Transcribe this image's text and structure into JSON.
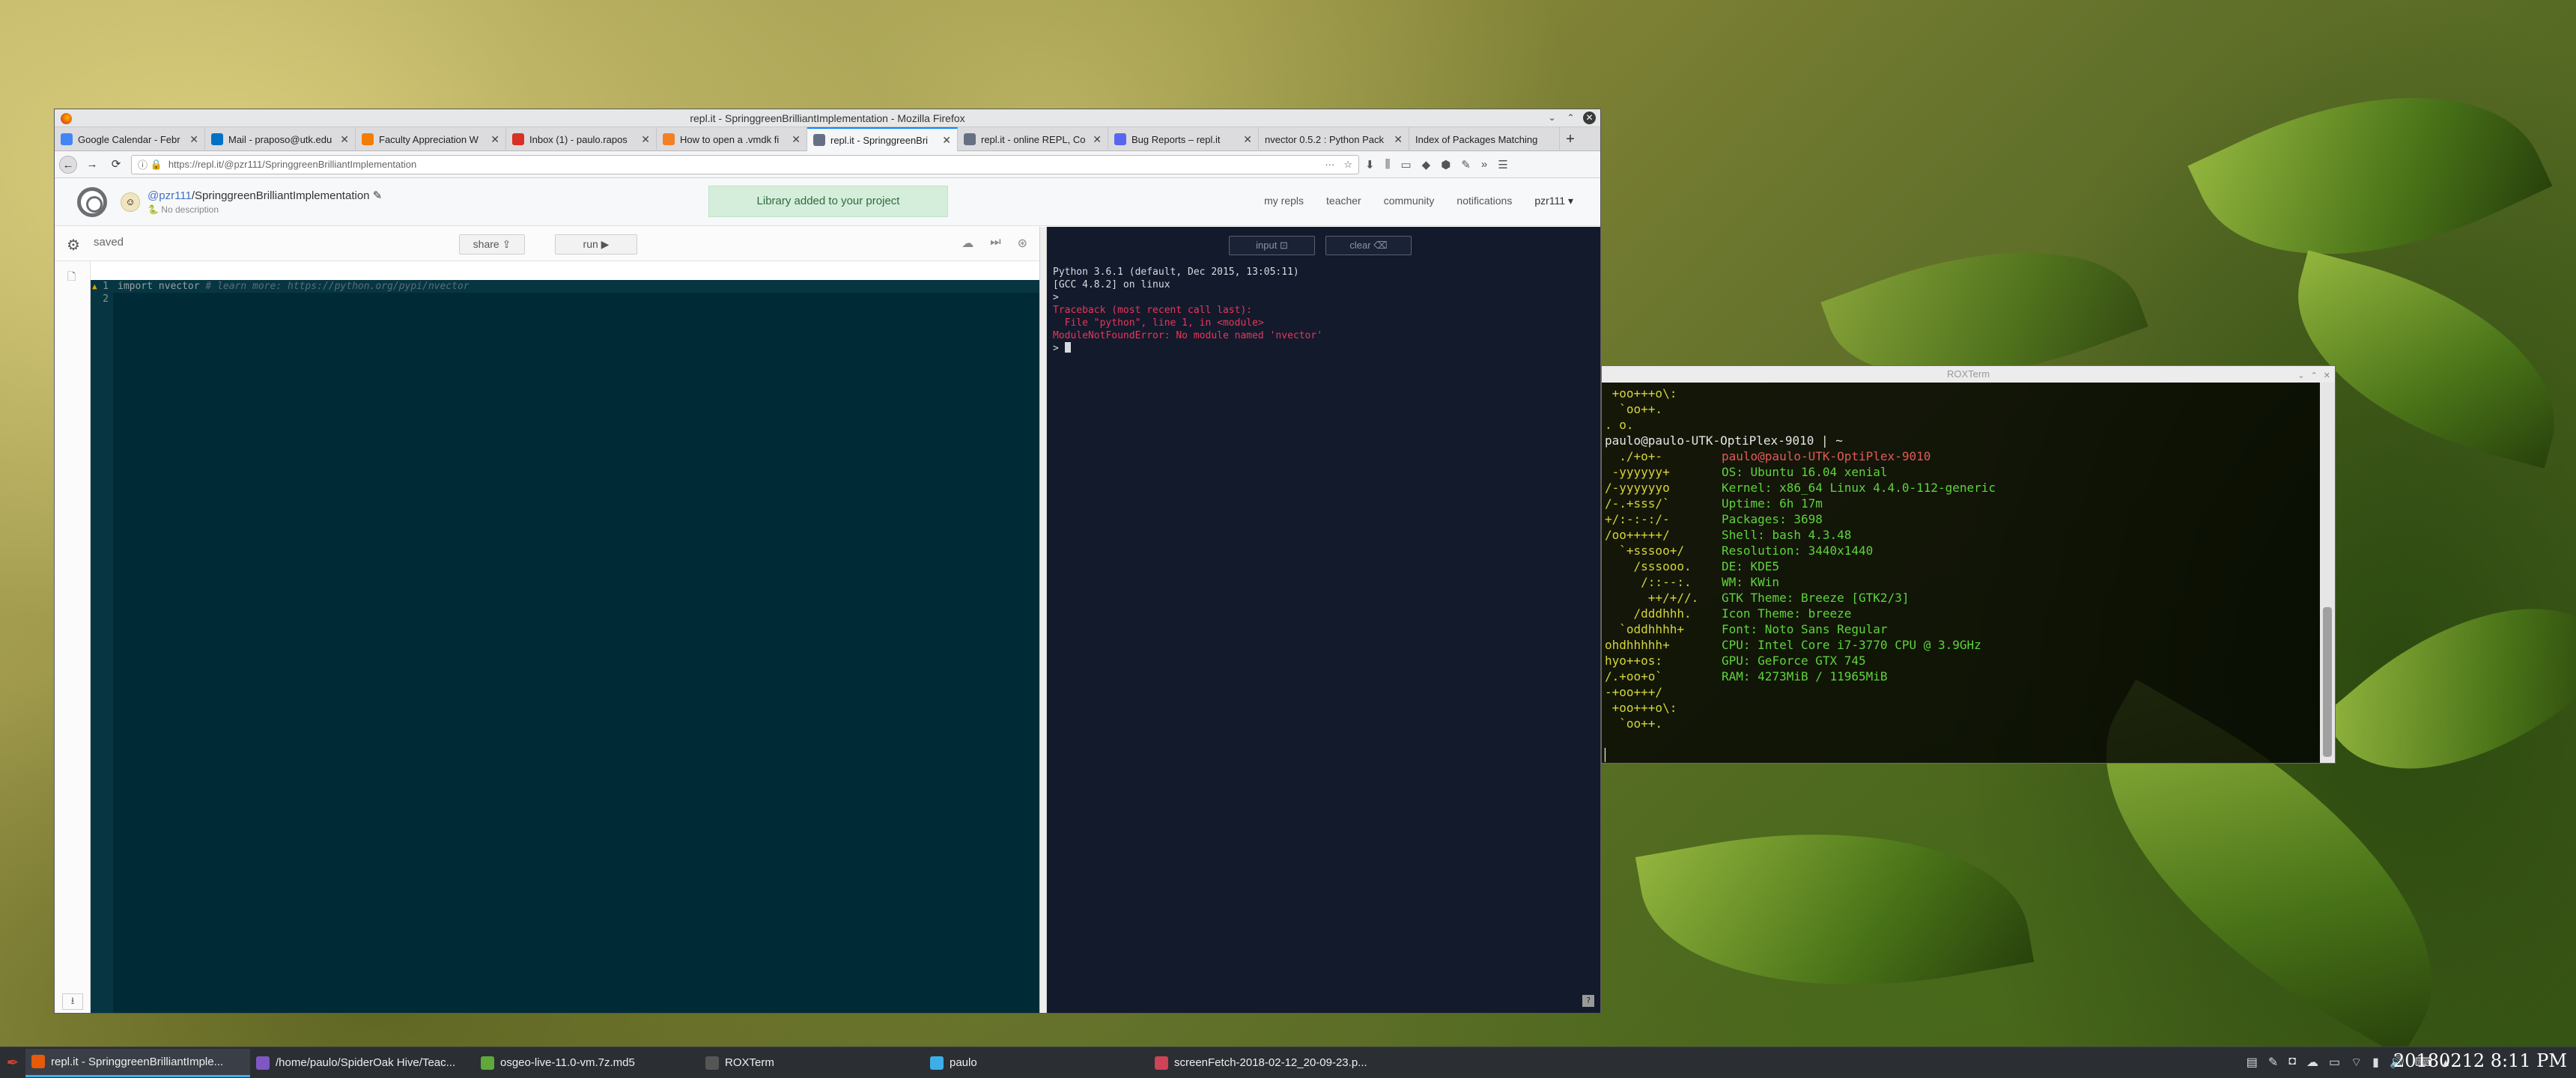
{
  "firefox": {
    "window_title": "repl.it - SpringgreenBrilliantImplementation - Mozilla Firefox",
    "tabs": [
      {
        "label": "Google Calendar - Febr",
        "color": "#4285f4"
      },
      {
        "label": "Mail - praposo@utk.edu",
        "color": "#0072c6"
      },
      {
        "label": "Faculty Appreciation W",
        "color": "#f57c00"
      },
      {
        "label": "Inbox (1) - paulo.rapos",
        "color": "#d93025"
      },
      {
        "label": "How to open a .vmdk fi",
        "color": "#f48024"
      },
      {
        "label": "repl.it - SpringgreenBri",
        "color": "#667085"
      },
      {
        "label": "repl.it - online REPL, Co",
        "color": "#667085"
      },
      {
        "label": "Bug Reports – repl.it",
        "color": "#5865f2"
      },
      {
        "label": "nvector 0.5.2 : Python Pack",
        "color": "#3775a9"
      },
      {
        "label": "Index of Packages Matching",
        "color": "#3775a9"
      }
    ],
    "url": "https://repl.it/@pzr111/SpringgreenBrilliantImplementation"
  },
  "repl": {
    "user": "@pzr111",
    "project": "SpringgreenBrilliantImplementation",
    "description": "No description",
    "toast": "Library added to your project",
    "nav": [
      "my repls",
      "teacher",
      "community",
      "notifications"
    ],
    "username": "pzr111 ▾",
    "saved": "saved",
    "share": "share",
    "run": "run ▶",
    "input": "input",
    "clear": "clear",
    "editor_lines": [
      "1",
      "2"
    ],
    "code_import": "import nvector ",
    "code_comment": "# learn more: https://python.org/pypi/nvector",
    "console": {
      "line1": "Python 3.6.1 (default, Dec 2015, 13:05:11)",
      "line2": "[GCC 4.8.2] on linux",
      "prompt1": ">",
      "err1": "Traceback (most recent call last):",
      "err2": "  File \"python\", line 1, in <module>",
      "err3": "ModuleNotFoundError: No module named 'nvector'",
      "prompt2": "> "
    }
  },
  "roxterm": {
    "title": "ROXTerm",
    "top_art": [
      " +oo+++o\\:",
      "  `oo++.",
      ". o."
    ],
    "prompt": "paulo@paulo-UTK-OptiPlex-9010 | ~",
    "art": [
      "  ./+o+-",
      " -yyyyyy+",
      "/-yyyyyyo",
      "/-.+sss/`",
      "+/:-:-:/-",
      "/oo+++++/",
      "  `+sssoo+/",
      "    /sssooo.",
      "     /::--:.",
      "      ++/+//.",
      "    /dddhhh.",
      "  `oddhhhh+",
      "ohdhhhhh+",
      "hyo++os:",
      "/.+oo+o`",
      "-+oo+++/",
      " +oo+++o\\:",
      "  `oo++.",
      ""
    ],
    "host": "paulo@paulo-UTK-OptiPlex-9010",
    "info": [
      [
        "OS: ",
        "Ubuntu 16.04 xenial"
      ],
      [
        "Kernel: ",
        "x86_64 Linux 4.4.0-112-generic"
      ],
      [
        "Uptime: ",
        "6h 17m"
      ],
      [
        "Packages: ",
        "3698"
      ],
      [
        "Shell: ",
        "bash 4.3.48"
      ],
      [
        "Resolution: ",
        "3440x1440"
      ],
      [
        "DE: ",
        "KDE5"
      ],
      [
        "WM: ",
        "KWin"
      ],
      [
        "GTK Theme: ",
        "Breeze [GTK2/3]"
      ],
      [
        "Icon Theme: ",
        "breeze"
      ],
      [
        "Font: ",
        "Noto Sans Regular"
      ],
      [
        "CPU: ",
        "Intel Core i7-3770 CPU @ 3.9GHz"
      ],
      [
        "GPU: ",
        "GeForce GTX 745"
      ],
      [
        "RAM: ",
        "4273MiB / 11965MiB"
      ]
    ]
  },
  "taskbar": {
    "items": [
      {
        "label": "repl.it - SpringgreenBrilliantImple...",
        "color": "#e55b0a"
      },
      {
        "label": "/home/paulo/SpiderOak Hive/Teac...",
        "color": "#7e57c2"
      },
      {
        "label": "osgeo-live-11.0-vm.7z.md5",
        "color": "#5fa83a"
      },
      {
        "label": "ROXTerm",
        "color": "#555555"
      },
      {
        "label": "paulo",
        "color": "#3daee9"
      },
      {
        "label": "screenFetch-2018-02-12_20-09-23.p...",
        "color": "#cc4455"
      }
    ],
    "clock": "20180212 8:11 PM"
  }
}
